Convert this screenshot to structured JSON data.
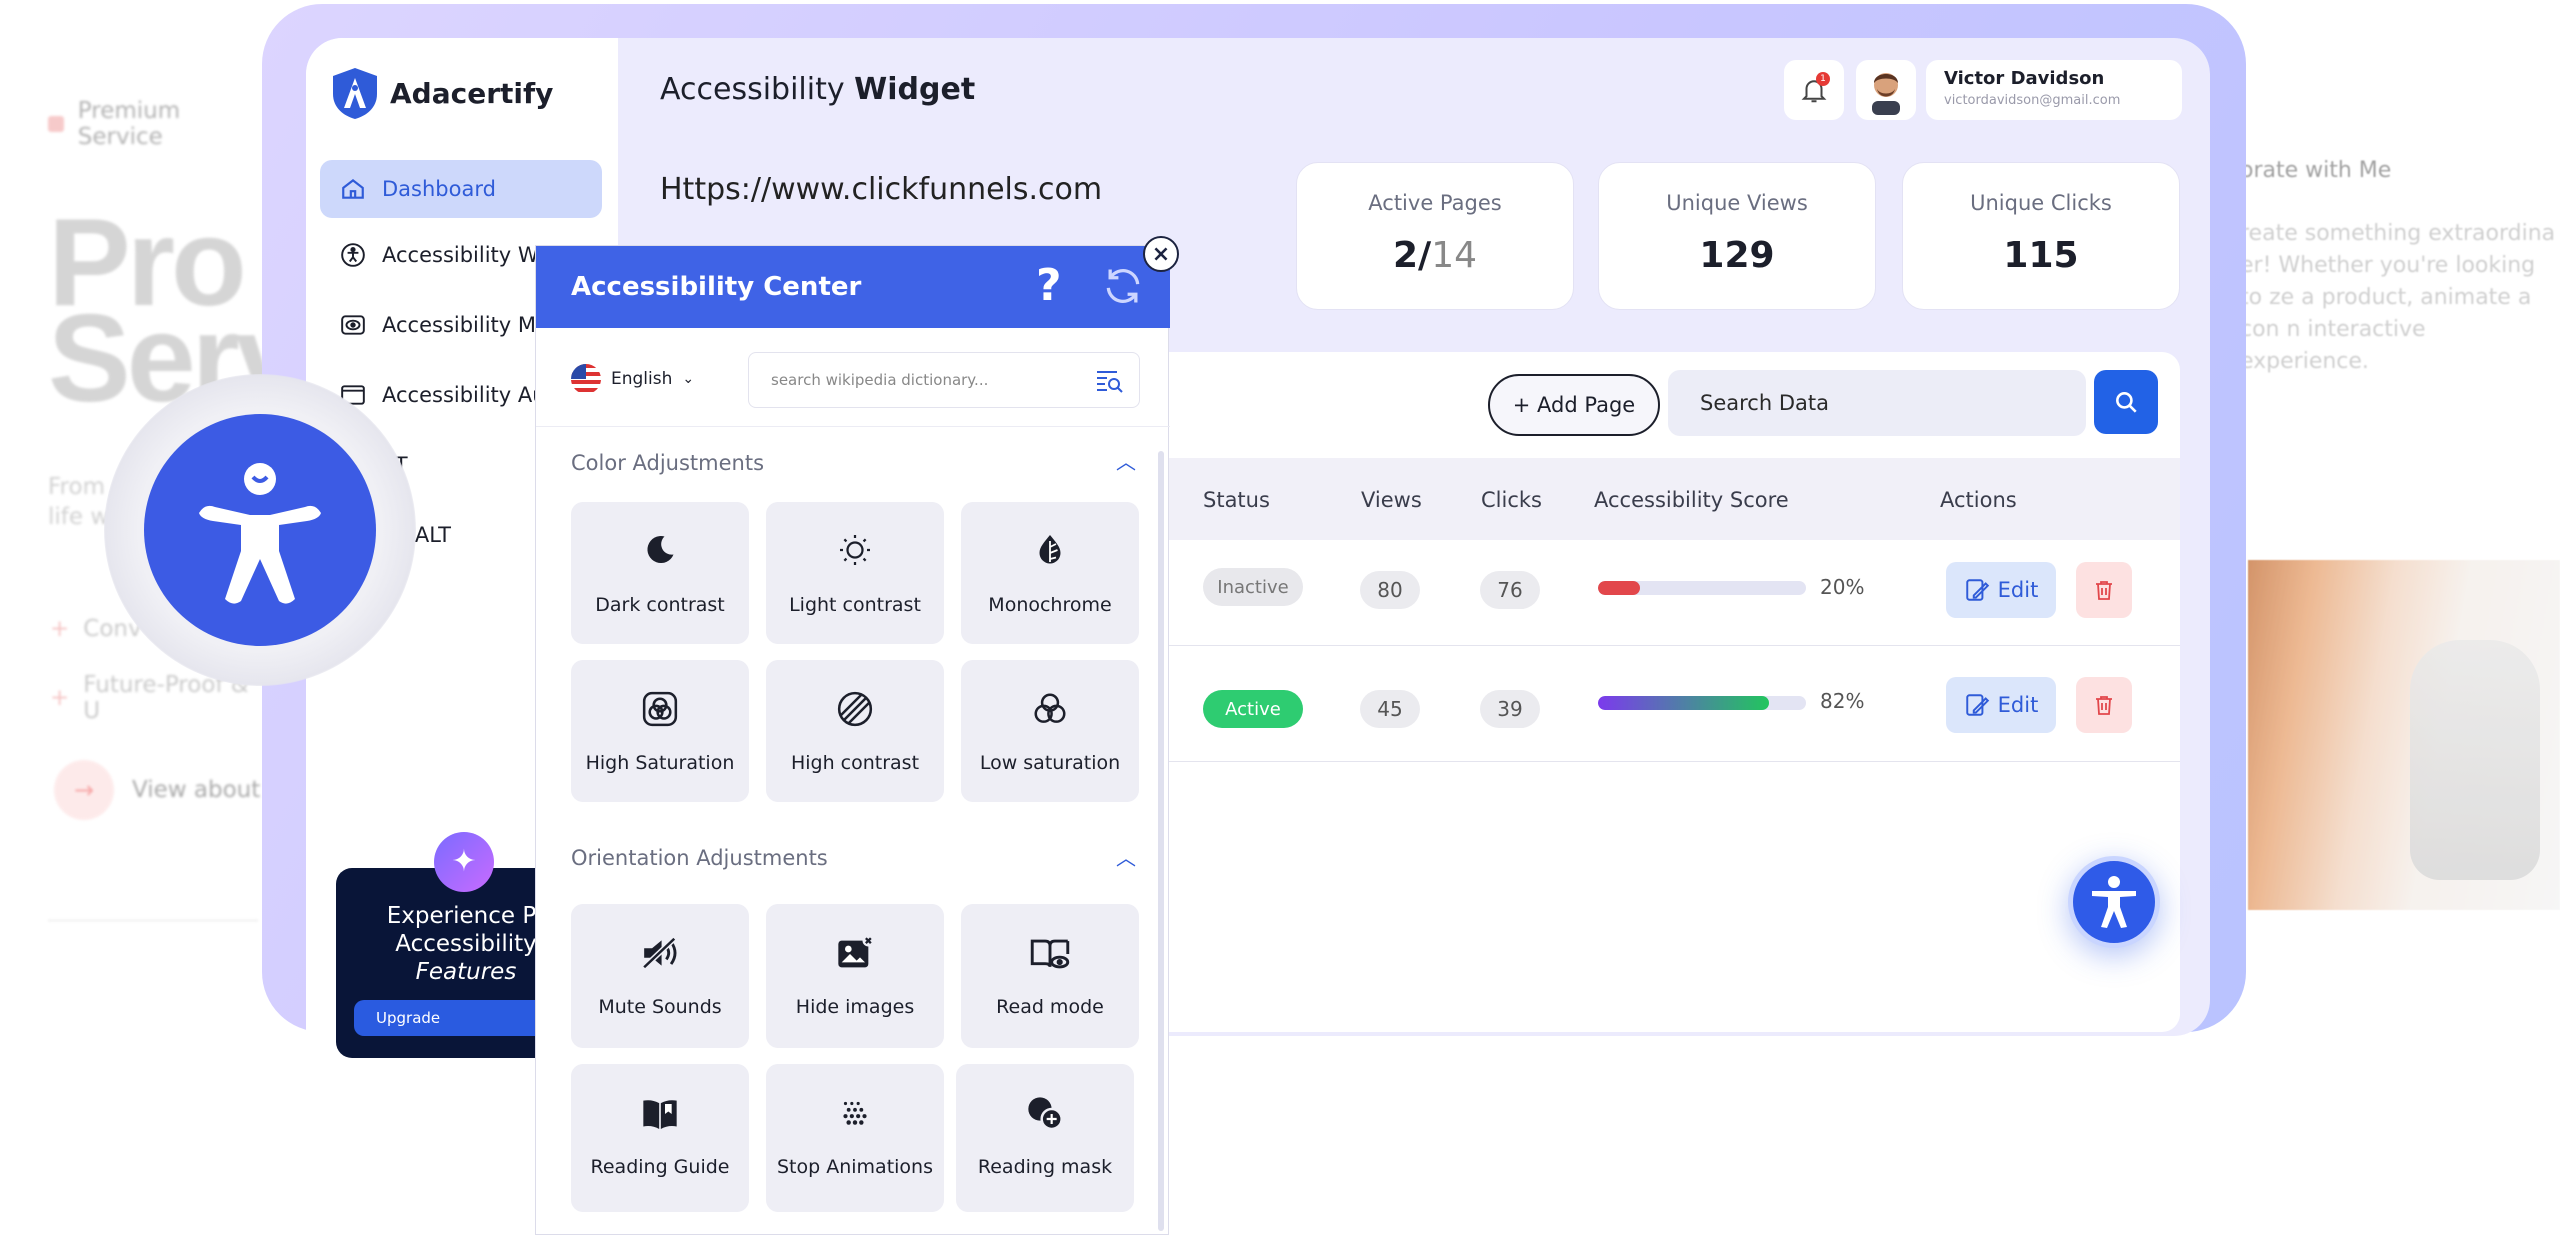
{
  "background_left": {
    "premium_label": "Premium Service",
    "big_text_line1": "Pro",
    "big_text_line2": "Serv",
    "subtext_line1": "From",
    "subtext_line2": "life w",
    "list": [
      "Conv",
      "Future-Proof & U"
    ],
    "view_about": "View about"
  },
  "background_right": {
    "title": "orate with Me",
    "paragraph": "reate something extraordina er! Whether you're looking to ze a product, animate a con n interactive experience."
  },
  "app": {
    "name": "Adacertify",
    "brand_color": "#2f5bd8"
  },
  "sidebar": {
    "items": [
      {
        "label": "Dashboard",
        "icon": "home-icon",
        "active": true
      },
      {
        "label": "Accessibility Widget",
        "icon": "accessibility-icon"
      },
      {
        "label": "Accessibility Mo",
        "icon": "eye-icon"
      },
      {
        "label": "Accessibility Au",
        "icon": "window-icon"
      },
      {
        "label": "AT",
        "icon": "text-icon"
      },
      {
        "label": "ge ALT",
        "icon": "image-icon"
      }
    ],
    "promo": {
      "line1": "Experience Pr",
      "line2": "Accessibility",
      "line3": "Features",
      "upgrade": "Upgrade"
    }
  },
  "header": {
    "title_light": "Accessibility",
    "title_bold": "Widget",
    "notification_count": "1",
    "user_name": "Victor Davidson",
    "user_email": "victordavidson@gmail.com"
  },
  "site_url": "Https://www.clickfunnels.com",
  "stats": [
    {
      "label": "Active Pages",
      "value": "2/",
      "value_dim": "14"
    },
    {
      "label": "Unique Views",
      "value": "129"
    },
    {
      "label": "Unique Clicks",
      "value": "115"
    }
  ],
  "table": {
    "add_page": "+ Add Page",
    "search_placeholder": "Search Data",
    "columns": [
      "Status",
      "Views",
      "Clicks",
      "Accessibility Score",
      "Actions"
    ],
    "rows": [
      {
        "status": "Inactive",
        "views": "80",
        "clicks": "76",
        "score": 20,
        "score_label": "20%",
        "edit": "Edit"
      },
      {
        "status": "Active",
        "views": "45",
        "clicks": "39",
        "score": 82,
        "score_label": "82%",
        "edit": "Edit"
      }
    ]
  },
  "modal": {
    "title": "Accessibility Center",
    "help": "?",
    "close": "×",
    "language": "English",
    "search_placeholder": "search wikipedia dictionary...",
    "color_section": "Color Adjustments",
    "color_tiles": [
      "Dark contrast",
      "Light contrast",
      "Monochrome",
      "High Saturation",
      "High contrast",
      "Low saturation"
    ],
    "orientation_section": "Orientation Adjustments",
    "orientation_tiles": [
      "Mute Sounds",
      "Hide images",
      "Read mode",
      "Reading Guide",
      "Stop Animations",
      "Reading mask"
    ]
  },
  "colors": {
    "modal_header": "#3f63e6",
    "active_status": "#2ecc71",
    "inactive_status": "#e6e6ec",
    "low_score": "#e2474b",
    "delete_bg": "#fde1e1"
  }
}
